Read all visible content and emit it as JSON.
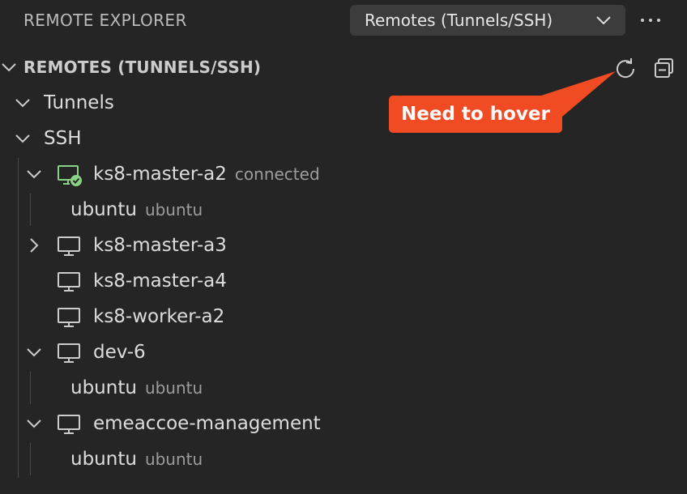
{
  "header": {
    "title": "REMOTE EXPLORER",
    "dropdown_selected": "Remotes (Tunnels/SSH)",
    "more_icon": "ellipsis-icon"
  },
  "section": {
    "title": "REMOTES (TUNNELS/SSH)",
    "refresh_icon": "refresh-icon",
    "collapse_icon": "collapse-all-icon"
  },
  "tree": {
    "tunnels_label": "Tunnels",
    "ssh_label": "SSH",
    "hosts": [
      {
        "name": "ks8-master-a2",
        "status": "connected",
        "expanded": true,
        "child_user": "ubuntu",
        "child_desc": "ubuntu"
      },
      {
        "name": "ks8-master-a3",
        "status": "",
        "expanded": false
      },
      {
        "name": "ks8-master-a4",
        "status": ""
      },
      {
        "name": "ks8-worker-a2",
        "status": ""
      },
      {
        "name": "dev-6",
        "status": "",
        "expanded": true,
        "child_user": "ubuntu",
        "child_desc": "ubuntu"
      },
      {
        "name": "emeaccoe-management",
        "status": "",
        "expanded": true,
        "child_user": "ubuntu",
        "child_desc": "ubuntu"
      }
    ]
  },
  "callout": {
    "text": "Need to hover"
  },
  "colors": {
    "background": "#252526",
    "connected_green": "#89d185",
    "callout": "#f04b23"
  }
}
